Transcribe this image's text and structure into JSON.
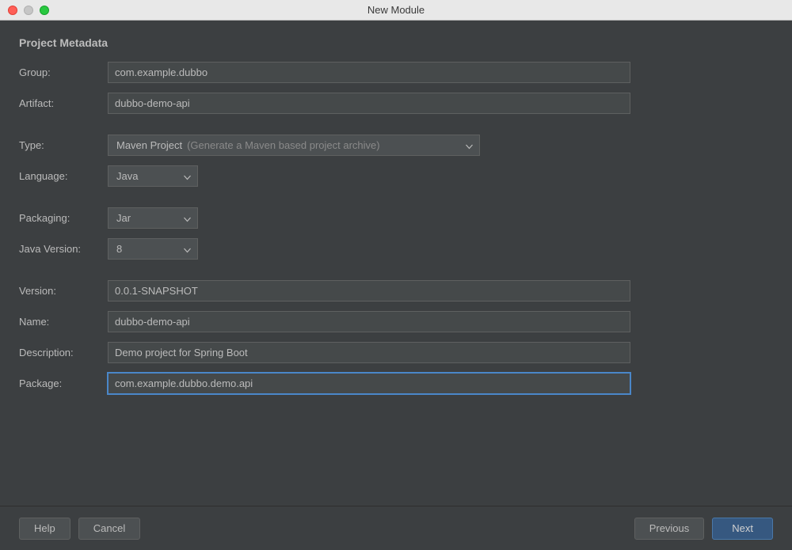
{
  "window": {
    "title": "New Module"
  },
  "section": {
    "title": "Project Metadata"
  },
  "labels": {
    "group": "Group:",
    "artifact": "Artifact:",
    "type": "Type:",
    "language": "Language:",
    "packaging": "Packaging:",
    "java_version": "Java Version:",
    "version": "Version:",
    "name": "Name:",
    "description": "Description:",
    "package": "Package:"
  },
  "fields": {
    "group": "com.example.dubbo",
    "artifact": "dubbo-demo-api",
    "type_value": "Maven Project",
    "type_hint": "(Generate a Maven based project archive)",
    "language": "Java",
    "packaging": "Jar",
    "java_version": "8",
    "version": "0.0.1-SNAPSHOT",
    "name": "dubbo-demo-api",
    "description": "Demo project for Spring Boot",
    "package": "com.example.dubbo.demo.api"
  },
  "footer": {
    "help": "Help",
    "cancel": "Cancel",
    "previous": "Previous",
    "next": "Next"
  }
}
